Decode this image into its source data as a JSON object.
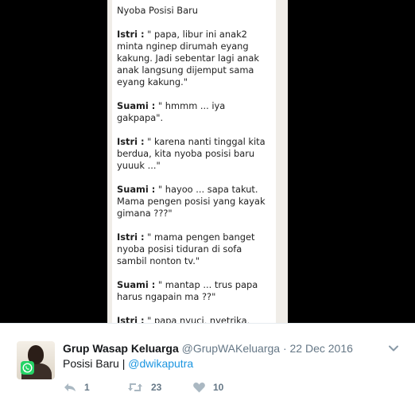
{
  "chat": {
    "title": "Nyoba Posisi Baru",
    "messages": [
      {
        "speaker": "Istri :",
        "text": " \" papa, libur ini  anak2 minta nginep dirumah eyang kakung. Jadi sebentar lagi anak anak langsung dijemput sama eyang kakung.\""
      },
      {
        "speaker": "Suami :",
        "text": " \" hmmm ... iya gakpapa\"."
      },
      {
        "speaker": "Istri :",
        "text": " \" karena nanti tinggal kita berdua, kita nyoba posisi baru yuuuk ...\""
      },
      {
        "speaker": "Suami :",
        "text": " \" hayoo ... sapa takut. Mama pengen posisi yang kayak gimana ???\""
      },
      {
        "speaker": "Istri :",
        "text": " \" mama pengen banget nyoba posisi tiduran di sofa sambil nonton tv.\""
      },
      {
        "speaker": "Suami :",
        "text": " \" mantap ... trus papa harus ngapain ma ??\""
      },
      {
        "speaker": "Istri :",
        "text": " \" papa nyuci, nyetrika, nyapu, sama ngepel !\""
      }
    ]
  },
  "tweet": {
    "display_name": "Grup Wasap Keluarga",
    "screen_name": "@GrupWAKeluarga",
    "separator": "·",
    "date": "22 Dec 2016",
    "text_prefix": "Posisi Baru | ",
    "mention": "@dwikaputra",
    "reply_count": "1",
    "retweet_count": "23",
    "like_count": "10",
    "icons": {
      "avatar_badge": "whatsapp-icon",
      "reply": "reply-icon",
      "retweet": "retweet-icon",
      "like": "heart-icon",
      "menu": "chevron-down-icon"
    }
  },
  "colors": {
    "link": "#1b95e0",
    "secondary_text": "#657786",
    "primary_text": "#14171a",
    "whatsapp_green": "#25d366"
  }
}
